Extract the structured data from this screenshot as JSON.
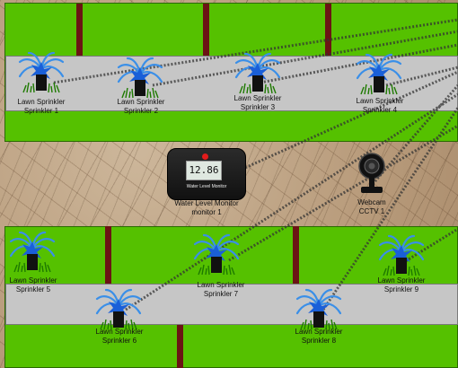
{
  "sprinklers": [
    {
      "line1": "Lawn Sprinkler",
      "line2": "Sprinkler 1"
    },
    {
      "line1": "Lawn Sprinkler",
      "line2": "Sprinkler 2"
    },
    {
      "line1": "Lawn Sprinkler",
      "line2": "Sprinkler 3"
    },
    {
      "line1": "Lawn Sprinkler",
      "line2": "Sprinkler 4"
    },
    {
      "line1": "Lawn Sprinkler",
      "line2": "Sprinkler 5"
    },
    {
      "line1": "Lawn Sprinkler",
      "line2": "Sprinkler 6"
    },
    {
      "line1": "Lawn Sprinkler",
      "line2": "Sprinkler 7"
    },
    {
      "line1": "Lawn Sprinkler",
      "line2": "Sprinkler 8"
    },
    {
      "line1": "Lawn Sprinkler",
      "line2": "Sprinkler 9"
    }
  ],
  "water_monitor": {
    "reading": "12.86",
    "device_caption": "Water Level Monitor",
    "line1": "Water Level Monitor",
    "line2": "monitor 1"
  },
  "webcam": {
    "line1": "Webcam",
    "line2": "CCTV 1"
  },
  "colors": {
    "grass": "#55c100",
    "path": "#c6c6c6",
    "post": "#6b1414",
    "spray": "#3a8fe8",
    "sprinkler_head": "#1a5fd8"
  },
  "icons": [
    "sprinkler-icon",
    "water-monitor-icon",
    "webcam-icon"
  ]
}
